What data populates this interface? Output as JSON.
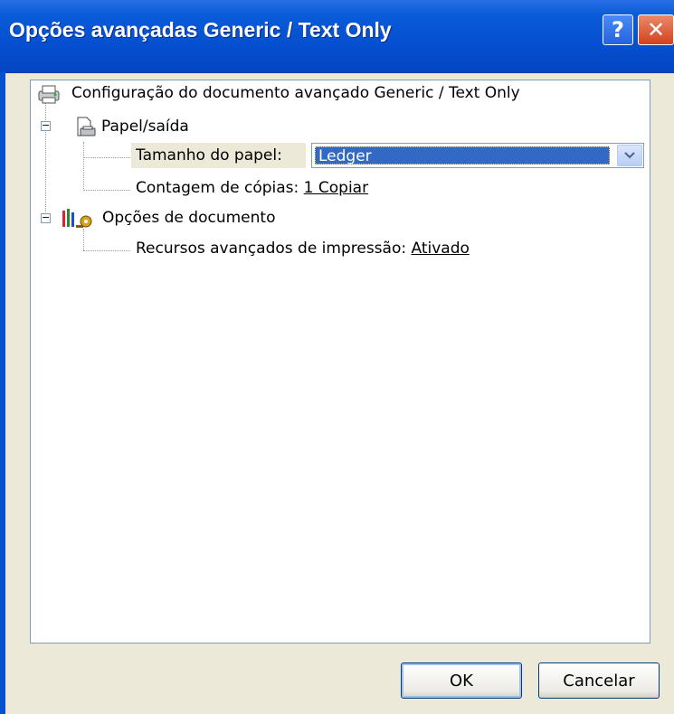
{
  "window": {
    "title": "Opções avançadas Generic / Text Only",
    "help_glyph": "?",
    "close_glyph": "✕"
  },
  "tree": {
    "root_label": "Configuração do documento avançado Generic / Text Only",
    "paper_output_label": "Papel/saída",
    "paper_size_label": "Tamanho do papel:",
    "paper_size_value": "Ledger",
    "copy_count_label": "Contagem de cópias:",
    "copy_count_value": "1 Copiar",
    "document_options_label": "Opções de documento",
    "advanced_features_label": "Recursos avançados de impressão:",
    "advanced_features_value": "Ativado",
    "expander_glyph": "−"
  },
  "buttons": {
    "ok": "OK",
    "cancel": "Cancelar"
  },
  "icons": {
    "root": "printer-icon",
    "paper": "paper-output-icon",
    "document": "document-options-icon",
    "dropdown": "chevron-down-icon"
  },
  "colors": {
    "titlebar": "#0550d0",
    "selection": "#316ac5",
    "dialog_bg": "#ece9d8"
  }
}
